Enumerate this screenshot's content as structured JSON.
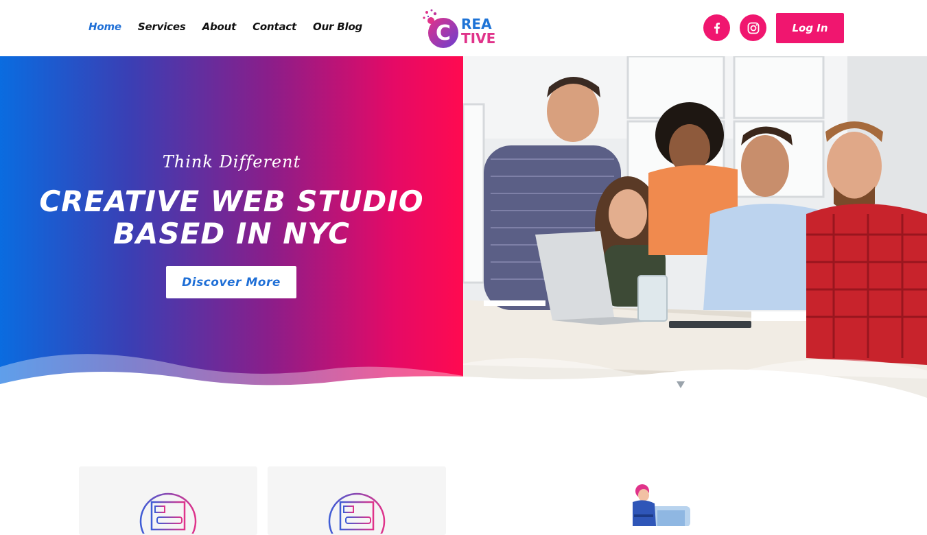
{
  "header": {
    "nav": [
      {
        "label": "Home",
        "active": true
      },
      {
        "label": "Services",
        "active": false
      },
      {
        "label": "About",
        "active": false
      },
      {
        "label": "Contact",
        "active": false
      },
      {
        "label": "Our Blog",
        "active": false
      }
    ],
    "logo": {
      "line1": "REA",
      "line2": "TIVE",
      "mark": "C"
    },
    "social": [
      {
        "icon": "facebook-icon"
      },
      {
        "icon": "instagram-icon"
      }
    ],
    "login_label": "Log In"
  },
  "hero": {
    "tagline": "Think Different",
    "headline_line1": "CREATIVE WEB STUDIO",
    "headline_line2": "BASED IN NYC",
    "cta_label": "Discover More"
  },
  "colors": {
    "accent_pink": "#f0166f",
    "accent_blue": "#1f6fd6",
    "gradient_start": "#0a6ce0",
    "gradient_end": "#ff0a50"
  }
}
